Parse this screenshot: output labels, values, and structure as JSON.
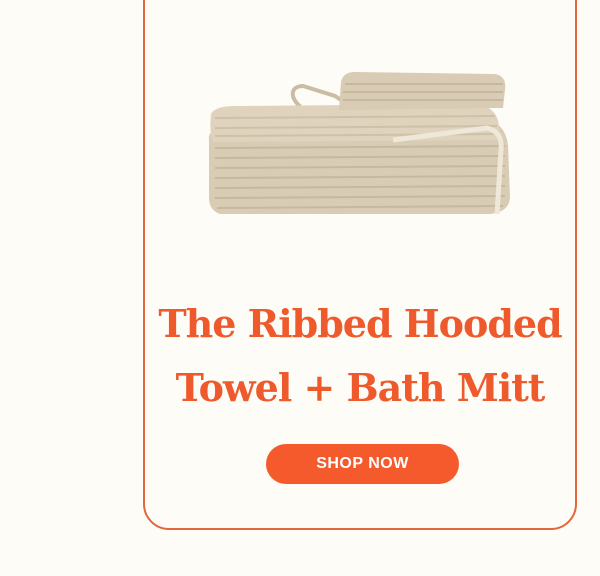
{
  "product": {
    "title_line1": "The Ribbed Hooded",
    "title_line2": "Towel + Bath Mitt",
    "image_icon": "folded-towel-image"
  },
  "cta": {
    "label": "SHOP NOW"
  },
  "colors": {
    "accent": "#ee5a2c",
    "button": "#f45a2b",
    "background": "#fdfcf7",
    "towel": "#d9ccb5"
  }
}
